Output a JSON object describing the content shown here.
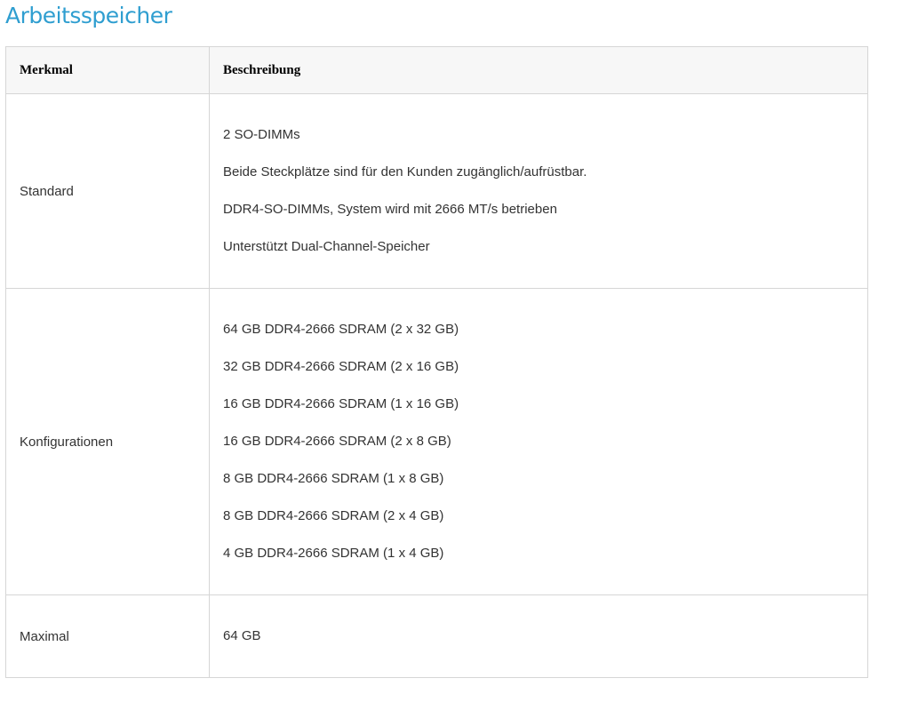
{
  "page": {
    "title": "Arbeitsspeicher"
  },
  "table": {
    "headers": [
      "Merkmal",
      "Beschreibung"
    ],
    "rows": [
      {
        "feature": "Standard",
        "description": [
          "2 SO-DIMMs",
          "Beide Steckplätze sind für den Kunden zugänglich/aufrüstbar.",
          "DDR4-SO-DIMMs, System wird mit 2666 MT/s betrieben",
          "Unterstützt Dual-Channel-Speicher"
        ]
      },
      {
        "feature": "Konfigurationen",
        "description": [
          "64 GB DDR4-2666 SDRAM (2 x 32 GB)",
          "32 GB DDR4-2666 SDRAM (2 x 16 GB)",
          "16 GB DDR4-2666 SDRAM (1 x 16 GB)",
          "16 GB DDR4-2666 SDRAM (2 x 8 GB)",
          "8 GB DDR4-2666 SDRAM (1 x 8 GB)",
          "8 GB DDR4-2666 SDRAM (2 x 4 GB)",
          "4 GB DDR4-2666 SDRAM (1 x 4 GB)"
        ]
      },
      {
        "feature": "Maximal",
        "description": [
          "64 GB"
        ]
      }
    ]
  },
  "colors": {
    "title": "#2f9ed0",
    "header_bg": "#f7f7f7",
    "border": "#d6d6d6",
    "text": "#333333"
  }
}
